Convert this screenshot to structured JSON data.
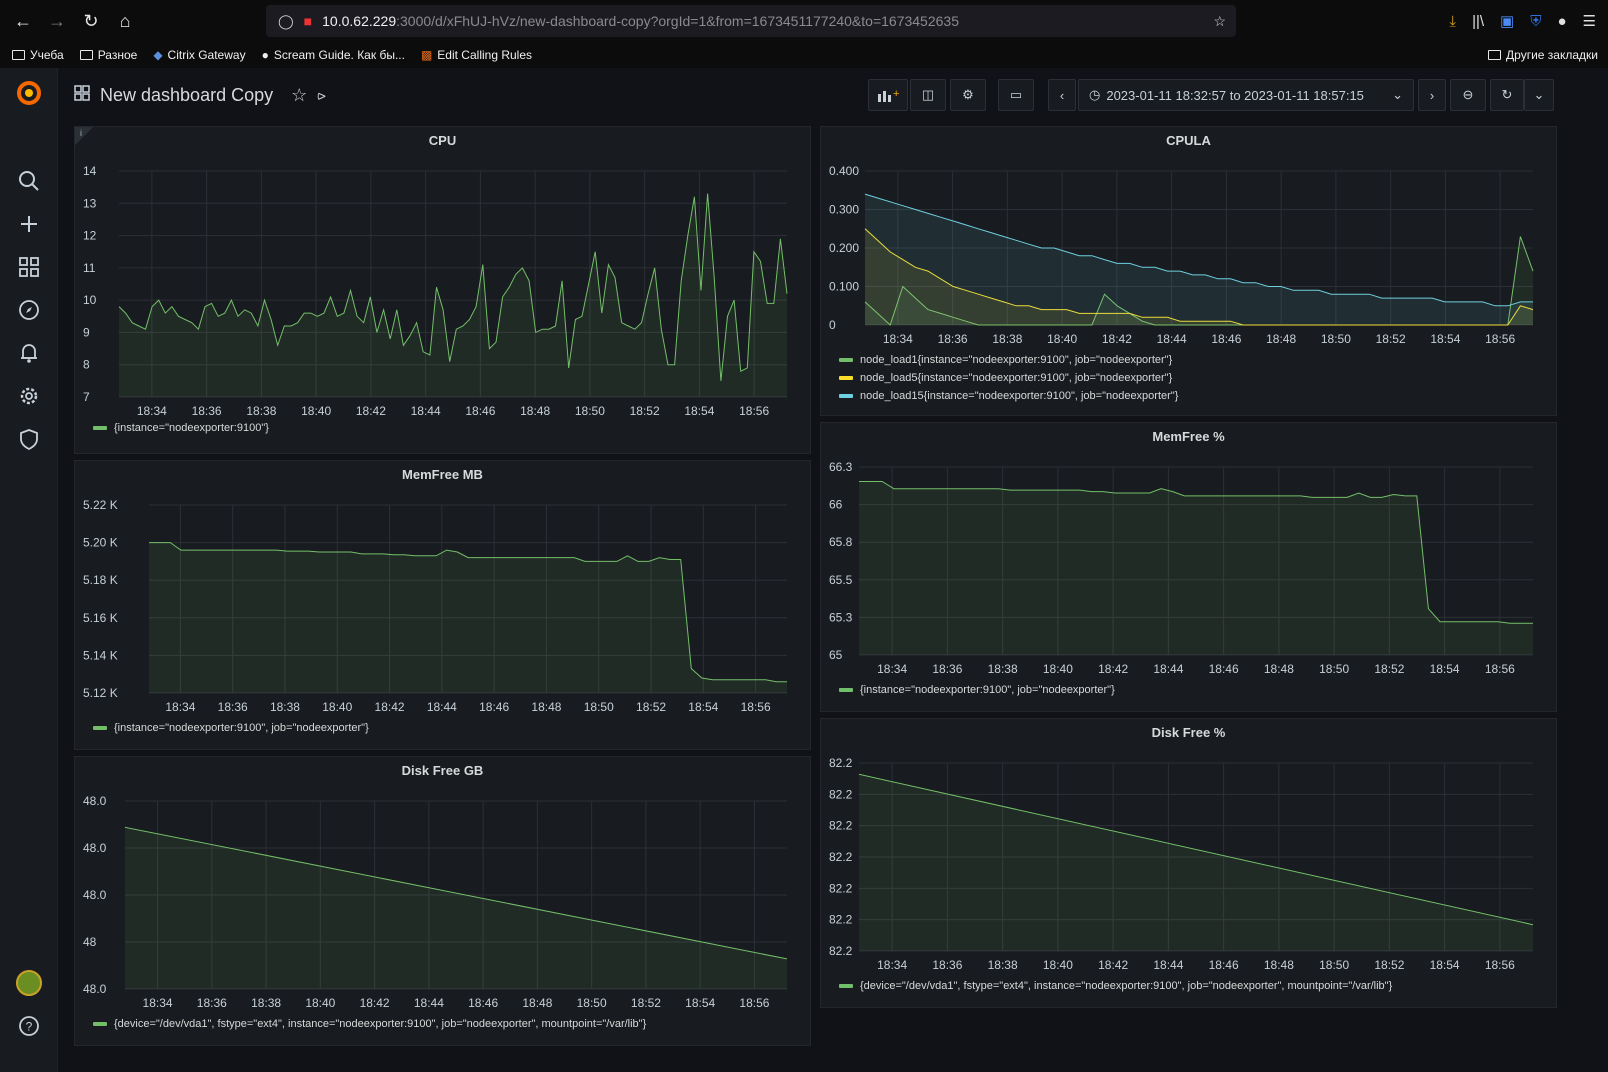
{
  "browser": {
    "url_host": "10.0.62.229",
    "url_path": ":3000/d/xFhUJ-hVz/new-dashboard-copy?orgId=1&from=1673451177240&to=1673452635",
    "bookmarks": [
      "Учеба",
      "Разное",
      "Citrix Gateway",
      "Scream Guide. Как бы...",
      "Edit Calling Rules"
    ],
    "other_bookmarks": "Другие закладки"
  },
  "dashboard": {
    "title": "New dashboard Copy",
    "time_range": "2023-01-11 18:32:57 to 2023-01-11 18:57:15"
  },
  "colors": {
    "green": "#73bf69",
    "yellow": "#fade2a",
    "blue": "#8ab8ff",
    "cyan": "#6ed0e0"
  },
  "panels": [
    {
      "id": "cpu",
      "title": "CPU",
      "chart_data": {
        "type": "line",
        "x": [
          "18:34",
          "18:36",
          "18:38",
          "18:40",
          "18:42",
          "18:44",
          "18:46",
          "18:48",
          "18:50",
          "18:52",
          "18:54",
          "18:56"
        ],
        "ylim": [
          7,
          14
        ],
        "yticks": [
          "14",
          "13",
          "12",
          "11",
          "10",
          "9",
          "8",
          "7"
        ],
        "series": [
          {
            "name": "{instance=\"nodeexporter:9100\"}",
            "color": "#73bf69",
            "values": [
              9.8,
              9.6,
              9.3,
              9.2,
              9.1,
              9.8,
              10.0,
              9.6,
              9.8,
              9.5,
              9.4,
              9.3,
              9.1,
              9.8,
              9.9,
              9.5,
              9.6,
              10.0,
              9.5,
              9.7,
              9.6,
              9.2,
              10.0,
              9.4,
              8.6,
              9.2,
              9.2,
              9.3,
              9.6,
              9.6,
              9.5,
              9.6,
              10.1,
              9.5,
              9.6,
              10.3,
              9.5,
              9.3,
              10.1,
              9.0,
              9.7,
              8.8,
              9.7,
              8.6,
              8.9,
              9.3,
              8.4,
              8.3,
              10.4,
              9.7,
              8.1,
              9.1,
              9.2,
              9.4,
              9.8,
              11.1,
              8.5,
              8.7,
              10.1,
              10.4,
              10.8,
              11.0,
              10.6,
              9.0,
              9.1,
              9.1,
              9.2,
              10.6,
              7.9,
              9.4,
              9.5,
              10.5,
              11.5,
              9.6,
              11.1,
              10.7,
              9.3,
              9.2,
              9.1,
              9.3,
              10.2,
              11.0,
              9.1,
              8.0,
              8.0,
              10.6,
              12.0,
              13.2,
              10.3,
              13.3,
              10.7,
              7.5,
              9.5,
              10.0,
              7.8,
              7.9,
              11.5,
              11.2,
              9.9,
              9.9,
              11.9,
              10.2
            ]
          }
        ]
      }
    },
    {
      "id": "cpula",
      "title": "CPULA",
      "chart_data": {
        "type": "area",
        "x": [
          "18:34",
          "18:36",
          "18:38",
          "18:40",
          "18:42",
          "18:44",
          "18:46",
          "18:48",
          "18:50",
          "18:52",
          "18:54",
          "18:56"
        ],
        "ylim": [
          0,
          0.4
        ],
        "yticks": [
          "0.400",
          "0.300",
          "0.200",
          "0.100",
          "0"
        ],
        "series": [
          {
            "name": "node_load1{instance=\"nodeexporter:9100\", job=\"nodeexporter\"}",
            "color": "#73bf69",
            "values": [
              0.06,
              0.03,
              0,
              0.1,
              0.07,
              0.04,
              0.03,
              0.02,
              0.01,
              0,
              0,
              0,
              0,
              0,
              0,
              0,
              0,
              0,
              0,
              0.08,
              0.05,
              0.03,
              0.01,
              0,
              0,
              0,
              0,
              0,
              0,
              0,
              0,
              0,
              0,
              0,
              0,
              0,
              0,
              0,
              0,
              0,
              0,
              0,
              0,
              0,
              0,
              0,
              0,
              0,
              0,
              0,
              0,
              0,
              0.23,
              0.14
            ]
          },
          {
            "name": "node_load5{instance=\"nodeexporter:9100\", job=\"nodeexporter\"}",
            "color": "#fade2a",
            "values": [
              0.25,
              0.22,
              0.19,
              0.17,
              0.15,
              0.14,
              0.12,
              0.1,
              0.09,
              0.08,
              0.07,
              0.06,
              0.05,
              0.05,
              0.04,
              0.04,
              0.04,
              0.03,
              0.03,
              0.03,
              0.03,
              0.03,
              0.02,
              0.02,
              0.02,
              0.01,
              0.01,
              0.01,
              0.01,
              0.01,
              0,
              0,
              0,
              0,
              0,
              0,
              0,
              0,
              0,
              0,
              0,
              0,
              0,
              0,
              0,
              0,
              0,
              0,
              0,
              0,
              0,
              0,
              0.05,
              0.04
            ]
          },
          {
            "name": "node_load15{instance=\"nodeexporter:9100\", job=\"nodeexporter\"}",
            "color": "#6ed0e0",
            "values": [
              0.34,
              0.33,
              0.32,
              0.31,
              0.3,
              0.29,
              0.28,
              0.27,
              0.26,
              0.25,
              0.24,
              0.23,
              0.22,
              0.21,
              0.2,
              0.2,
              0.19,
              0.18,
              0.18,
              0.17,
              0.16,
              0.16,
              0.15,
              0.15,
              0.14,
              0.14,
              0.13,
              0.13,
              0.12,
              0.12,
              0.11,
              0.11,
              0.1,
              0.1,
              0.09,
              0.09,
              0.09,
              0.08,
              0.08,
              0.08,
              0.08,
              0.07,
              0.07,
              0.07,
              0.07,
              0.07,
              0.06,
              0.06,
              0.06,
              0.06,
              0.05,
              0.05,
              0.06,
              0.06
            ]
          }
        ]
      }
    },
    {
      "id": "memfree-mb",
      "title": "MemFree MB",
      "chart_data": {
        "type": "area",
        "x": [
          "18:34",
          "18:36",
          "18:38",
          "18:40",
          "18:42",
          "18:44",
          "18:46",
          "18:48",
          "18:50",
          "18:52",
          "18:54",
          "18:56"
        ],
        "ylim": [
          5120,
          5220
        ],
        "yticks": [
          "5.22 K",
          "5.20 K",
          "5.18 K",
          "5.16 K",
          "5.14 K",
          "5.12 K"
        ],
        "series": [
          {
            "name": "{instance=\"nodeexporter:9100\", job=\"nodeexporter\"}",
            "color": "#73bf69",
            "values": [
              5200,
              5200,
              5200,
              5196,
              5196,
              5196,
              5196,
              5196,
              5196,
              5196,
              5196,
              5196,
              5196,
              5195.5,
              5195.5,
              5195.5,
              5195,
              5195,
              5195,
              5195,
              5194,
              5194,
              5194,
              5193.5,
              5193.5,
              5193,
              5193,
              5193,
              5196,
              5195,
              5192,
              5192,
              5192,
              5192,
              5192,
              5192,
              5192,
              5192,
              5192,
              5192,
              5192,
              5190,
              5190,
              5190,
              5190,
              5193,
              5190,
              5190,
              5192,
              5191,
              5191,
              5133,
              5128,
              5127,
              5127,
              5127,
              5127,
              5127,
              5127,
              5126,
              5126
            ]
          }
        ]
      }
    },
    {
      "id": "memfree-pct",
      "title": "MemFree %",
      "chart_data": {
        "type": "area",
        "x": [
          "18:34",
          "18:36",
          "18:38",
          "18:40",
          "18:42",
          "18:44",
          "18:46",
          "18:48",
          "18:50",
          "18:52",
          "18:54",
          "18:56"
        ],
        "ylim": [
          65,
          66.3
        ],
        "yticks": [
          "66.3",
          "66",
          "65.8",
          "65.5",
          "65.3",
          "65"
        ],
        "series": [
          {
            "name": "{instance=\"nodeexporter:9100\", job=\"nodeexporter\"}",
            "color": "#73bf69",
            "values": [
              66.2,
              66.2,
              66.2,
              66.15,
              66.15,
              66.15,
              66.15,
              66.15,
              66.15,
              66.15,
              66.15,
              66.15,
              66.15,
              66.14,
              66.14,
              66.14,
              66.14,
              66.14,
              66.14,
              66.14,
              66.13,
              66.13,
              66.12,
              66.12,
              66.12,
              66.12,
              66.15,
              66.13,
              66.1,
              66.1,
              66.1,
              66.1,
              66.1,
              66.1,
              66.1,
              66.1,
              66.1,
              66.1,
              66.1,
              66.09,
              66.09,
              66.09,
              66.09,
              66.12,
              66.09,
              66.09,
              66.11,
              66.1,
              66.1,
              65.32,
              65.23,
              65.23,
              65.23,
              65.23,
              65.23,
              65.23,
              65.22,
              65.22,
              65.22
            ]
          }
        ]
      }
    },
    {
      "id": "disk-gb",
      "title": "Disk Free GB",
      "chart_data": {
        "type": "area",
        "x": [
          "18:34",
          "18:36",
          "18:38",
          "18:40",
          "18:42",
          "18:44",
          "18:46",
          "18:48",
          "18:50",
          "18:52",
          "18:54",
          "18:56"
        ],
        "ylim": [
          0,
          1
        ],
        "yticks": [
          "48.0",
          "48.0",
          "48.0",
          "48",
          "48.0"
        ],
        "series": [
          {
            "name": "{device=\"/dev/vda1\", fstype=\"ext4\", instance=\"nodeexporter:9100\", job=\"nodeexporter\", mountpoint=\"/var/lib\"}",
            "color": "#73bf69",
            "values": [
              0.86,
              0.16
            ]
          }
        ]
      }
    },
    {
      "id": "disk-pct",
      "title": "Disk Free %",
      "chart_data": {
        "type": "area",
        "x": [
          "18:34",
          "18:36",
          "18:38",
          "18:40",
          "18:42",
          "18:44",
          "18:46",
          "18:48",
          "18:50",
          "18:52",
          "18:54",
          "18:56"
        ],
        "ylim": [
          0,
          1
        ],
        "yticks": [
          "82.2",
          "82.2",
          "82.2",
          "82.2",
          "82.2",
          "82.2",
          "82.2"
        ],
        "series": [
          {
            "name": "{device=\"/dev/vda1\", fstype=\"ext4\", instance=\"nodeexporter:9100\", job=\"nodeexporter\", mountpoint=\"/var/lib\"}",
            "color": "#73bf69",
            "values": [
              0.94,
              0.14
            ]
          }
        ]
      }
    }
  ]
}
